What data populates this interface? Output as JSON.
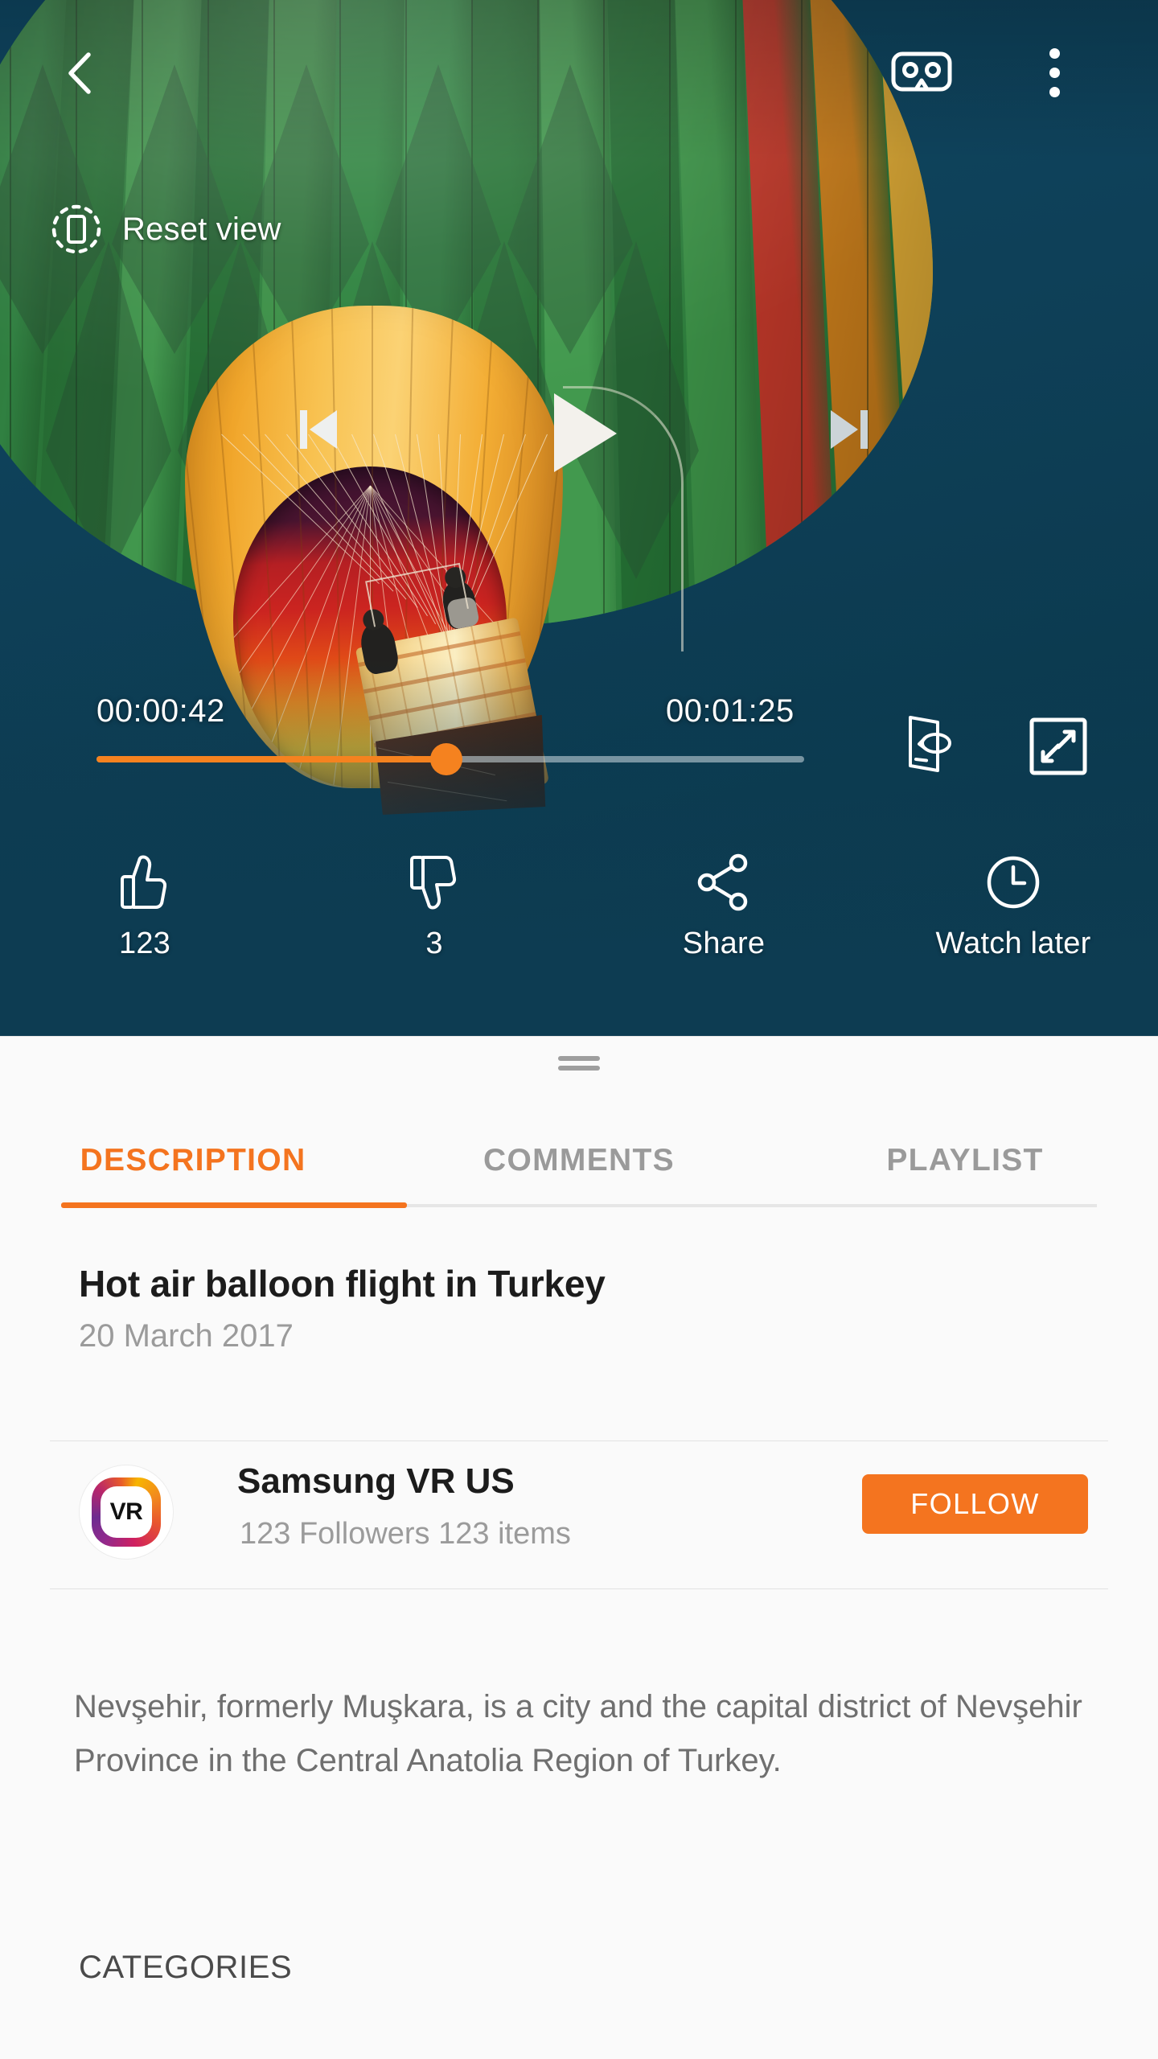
{
  "topbar": {
    "back_icon": "chevron-left-icon",
    "vr_icon": "vr-goggles-icon",
    "more_icon": "overflow-menu-icon"
  },
  "overlay": {
    "reset_view_label": "Reset view",
    "reset_view_icon": "reset-orientation-icon"
  },
  "transport": {
    "previous_icon": "skip-previous-icon",
    "play_icon": "play-icon",
    "next_icon": "skip-next-icon"
  },
  "timeline": {
    "current_time": "00:00:42",
    "total_time": "00:01:25",
    "progress_percent": 49.4,
    "track_color": "#d2dee4",
    "fill_color": "#f5821f",
    "rotate_icon": "rotate-screen-icon",
    "expand_icon": "fullscreen-expand-icon"
  },
  "actions": [
    {
      "icon": "thumbs-up-icon",
      "label": "123",
      "name": "like-button"
    },
    {
      "icon": "thumbs-down-icon",
      "label": "3",
      "name": "dislike-button"
    },
    {
      "icon": "share-icon",
      "label": "Share",
      "name": "share-button"
    },
    {
      "icon": "clock-icon",
      "label": "Watch later",
      "name": "watch-later-button"
    }
  ],
  "sheet": {
    "tabs": [
      {
        "label": "DESCRIPTION",
        "active": true
      },
      {
        "label": "COMMENTS",
        "active": false
      },
      {
        "label": "PLAYLIST",
        "active": false
      }
    ],
    "active_tab_color": "#f4741f",
    "inactive_tab_color": "#9a9a9a"
  },
  "video": {
    "title": "Hot air balloon flight in Turkey",
    "date": "20 March 2017"
  },
  "channel": {
    "avatar_text": "VR",
    "name": "Samsung VR US",
    "stats": "123 Followers  123 items",
    "follow_label": "FOLLOW",
    "follow_color": "#f4741f"
  },
  "description": {
    "text": "Nevşehir, formerly Muşkara, is a city and the capital district of Nevşehir Province in the Central Anatolia Region of Turkey."
  },
  "categories": {
    "heading": "CATEGORIES"
  }
}
